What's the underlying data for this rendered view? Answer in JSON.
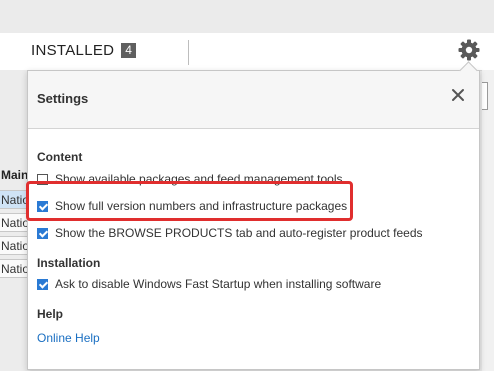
{
  "tabs": {
    "installed_label": "INSTALLED",
    "installed_count": "4"
  },
  "background": {
    "main_label": "Main",
    "rows": [
      "Natio",
      "Natio",
      "Natio",
      "Natio"
    ]
  },
  "settings": {
    "title": "Settings",
    "close_glyph": "×",
    "content_heading": "Content",
    "options": [
      {
        "label": "Show available packages and feed management tools",
        "checked": false
      },
      {
        "label": "Show full version numbers and infrastructure packages",
        "checked": true
      },
      {
        "label": "Show the BROWSE PRODUCTS tab and auto-register product feeds",
        "checked": true
      }
    ],
    "installation_heading": "Installation",
    "installation_options": [
      {
        "label": "Ask to disable Windows Fast Startup when installing software",
        "checked": true
      }
    ],
    "help_heading": "Help",
    "help_link": "Online Help"
  },
  "colors": {
    "accent": "#2a7ad4",
    "highlight": "#e02e2e",
    "link": "#1a6fc2"
  },
  "icons": {
    "settings": "gear-icon",
    "close": "close-icon"
  }
}
